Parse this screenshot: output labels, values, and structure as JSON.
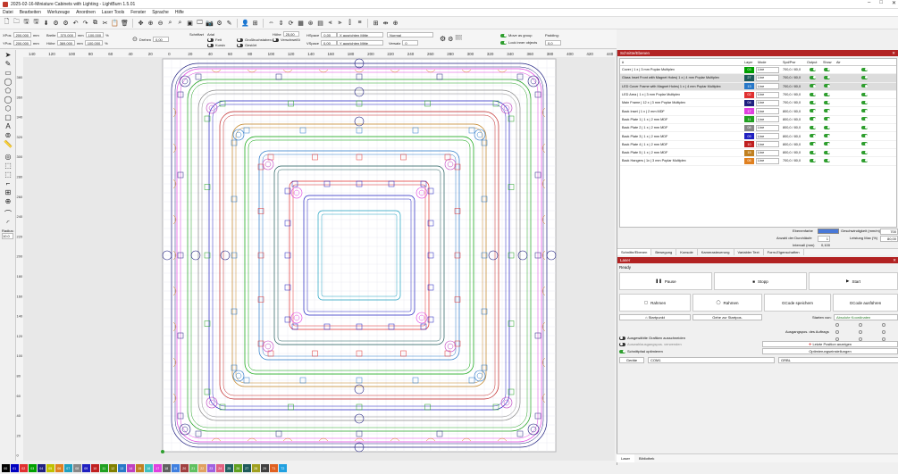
{
  "window": {
    "title": "2025-02-16-Miniature Cabinets with Lighting - LightBurn 1.5.01"
  },
  "menu": [
    "Datei",
    "Bearbeiten",
    "Werkzeuge",
    "Anordnen",
    "Laser Tools",
    "Fenster",
    "Sprache",
    "Hilfe"
  ],
  "props": {
    "xpos_label": "XPos",
    "xpos": "200.000",
    "ypos_label": "YPos",
    "ypos": "200.000",
    "unit": "mm",
    "width_label": "Breite",
    "width": "370.000",
    "height_label": "Höhe",
    "height": "369.000",
    "pct1": "100.000",
    "pct2": "100.000",
    "pct_unit": "%",
    "rotate_label": "Drehen",
    "rotate": "0,00",
    "font_label": "Schriftart",
    "font": "Arial",
    "height2_label": "Höhe",
    "height2": "25,00",
    "hspace_label": "HSpace",
    "hspace": "0,00",
    "vspace_label": "VSpace",
    "vspace": "0,00",
    "xalign": "X ausrichten Mitte",
    "yalign": "Y ausrichten Mitte",
    "normal": "Normal",
    "offset_label": "Versatz",
    "offset": "0",
    "bold": "Fett",
    "italic": "Kursiv",
    "upper": "Großbuchstaben",
    "welded": "Verschweißt",
    "distort": "Gestört",
    "move_group": "Move as group",
    "lock_inner": "Lock inner objects",
    "padding_label": "Padding:",
    "padding": "0,0"
  },
  "cuts": {
    "title": "Schnitte/Ebenen",
    "headers": {
      "hash": "#",
      "layer": "Layer",
      "mode": "Mode",
      "spdpwr": "Spd/Pwr",
      "output": "Output",
      "show": "Show",
      "air": "Air"
    },
    "rows": [
      {
        "name": "Cover | 1 x | 3 mm Poplar Multiplex",
        "num": "03",
        "color": "#00a000",
        "mode": "Line",
        "spd": "700,0 / 80,0"
      },
      {
        "name": "Glass Inset Front with Magnet Holes| 1 x | 4 mm Poplar Multiplex",
        "num": "27",
        "color": "#1e5a5a",
        "mode": "Line",
        "spd": "700,0 / 80,0"
      },
      {
        "name": "LED Cover Frame with Magnet Holes| 1 x | 4 mm Poplar Multiplex",
        "num": "13",
        "color": "#2878c8",
        "mode": "Line",
        "spd": "700,0 / 80,0"
      },
      {
        "name": "LED Area | 1 x | 3 mm Poplar Multiplex",
        "num": "02",
        "color": "#e03030",
        "mode": "Line",
        "spd": "700,0 / 80,0"
      },
      {
        "name": "Main Frame | 12 x | 3 mm Poplar Multiplex",
        "num": "04",
        "color": "#202080",
        "mode": "Line",
        "spd": "700,0 / 80,0"
      },
      {
        "name": "Back Inset | 1 x | 2 mm MDF",
        "num": "17",
        "color": "#e040e0",
        "mode": "Line",
        "spd": "800,0 / 80,0"
      },
      {
        "name": "Back Plate 1 | 1 x | 2 mm MDF",
        "num": "11",
        "color": "#20a020",
        "mode": "Line",
        "spd": "800,0 / 80,0"
      },
      {
        "name": "Back Plate 2 | 1 x | 2 mm MDF",
        "num": "08",
        "color": "#888888",
        "mode": "Line",
        "spd": "800,0 / 80,0"
      },
      {
        "name": "Back Plate 3 | 1 x | 2 mm MDF",
        "num": "09",
        "color": "#2020c0",
        "mode": "Line",
        "spd": "800,0 / 80,0"
      },
      {
        "name": "Back Plate 4 | 1 x | 2 mm MDF",
        "num": "10",
        "color": "#c02020",
        "mode": "Line",
        "spd": "800,0 / 80,0"
      },
      {
        "name": "Back Plate 5 | 1 x | 2 mm MDF",
        "num": "15",
        "color": "#c08020",
        "mode": "Line",
        "spd": "800,0 / 80,0"
      },
      {
        "name": "Back Hangers | 1x | 3 mm Poplar Multiplex",
        "num": "06",
        "color": "#e08020",
        "mode": "Line",
        "spd": "700,0 / 80,0"
      }
    ],
    "layer_color_label": "Ebenenfarbe",
    "speed_label": "Geschwindigkeit (mm/m)",
    "speed": "700",
    "passes_label": "Anzahl der Durchläufe",
    "passes": "1",
    "power_label": "Leistung Max (%)",
    "power": "80,00",
    "interval_label": "Intervall (mm)",
    "interval": "0,100"
  },
  "midtabs": [
    "Schnitte/Ebenen",
    "Bewegung",
    "Konsole",
    "Kamerasteuerung",
    "Variabler Text",
    "Form-Eigenschaften"
  ],
  "laser": {
    "title": "Laser",
    "status": "Ready",
    "pause": "Pause",
    "stop": "Stopp",
    "start": "Start",
    "frame1": "Rahmen",
    "frame2": "Rahmen",
    "save_gcode": "GCode speichern",
    "run_gcode": "GCode ausführen",
    "home": "Startpunkt",
    "goto_origin": "Gehe zur Startpos.",
    "start_from_label": "Starten von:",
    "start_from": "Absolute Koordinaten",
    "job_origin_label": "Ausgangspos. des Auftrags",
    "cut_selected": "Ausgewählte Grafiken ausschneiden",
    "use_selection_origin": "Auswahlausgangspos. verwenden",
    "optimize": "Schnittpfad optimieren",
    "show_last": "Letzte Position anzeigen",
    "opt_settings": "Optimierungseinstellungen",
    "devices_label": "Geräte",
    "device": "COM1",
    "device_type": "GRBL"
  },
  "bottomtabs": [
    "Laser",
    "Bibliothek"
  ],
  "radius_label": "Radius:",
  "radius": "10.0",
  "ruler_top": [
    "140",
    "120",
    "100",
    "80",
    "60",
    "40",
    "20",
    "0",
    "20",
    "40",
    "60",
    "80",
    "100",
    "120",
    "140",
    "160",
    "180",
    "200",
    "220",
    "240",
    "260",
    "280",
    "300",
    "320",
    "340",
    "360",
    "380",
    "400",
    "420",
    "440"
  ],
  "ruler_left": [
    "380",
    "360",
    "340",
    "320",
    "300",
    "280",
    "260",
    "240",
    "220",
    "200",
    "180",
    "160",
    "140",
    "120",
    "100",
    "80",
    "60",
    "40",
    "20",
    "0"
  ],
  "palette": [
    {
      "n": "00",
      "c": "#000000"
    },
    {
      "n": "01",
      "c": "#0000c0"
    },
    {
      "n": "02",
      "c": "#e03030"
    },
    {
      "n": "03",
      "c": "#00a000"
    },
    {
      "n": "04",
      "c": "#202080"
    },
    {
      "n": "05",
      "c": "#c0c000"
    },
    {
      "n": "06",
      "c": "#e08020"
    },
    {
      "n": "07",
      "c": "#20a0c0"
    },
    {
      "n": "08",
      "c": "#888888"
    },
    {
      "n": "09",
      "c": "#2020c0"
    },
    {
      "n": "10",
      "c": "#c02020"
    },
    {
      "n": "11",
      "c": "#20a020"
    },
    {
      "n": "12",
      "c": "#808000"
    },
    {
      "n": "13",
      "c": "#2878c8"
    },
    {
      "n": "14",
      "c": "#c040c0"
    },
    {
      "n": "15",
      "c": "#c08020"
    },
    {
      "n": "16",
      "c": "#40c0c0"
    },
    {
      "n": "17",
      "c": "#e040e0"
    },
    {
      "n": "18",
      "c": "#606060"
    },
    {
      "n": "19",
      "c": "#4080e0"
    },
    {
      "n": "20",
      "c": "#a04040"
    },
    {
      "n": "21",
      "c": "#60c060"
    },
    {
      "n": "22",
      "c": "#e0a060"
    },
    {
      "n": "23",
      "c": "#a060e0"
    },
    {
      "n": "24",
      "c": "#e06080"
    },
    {
      "n": "25",
      "c": "#206060"
    },
    {
      "n": "26",
      "c": "#60a020"
    },
    {
      "n": "27",
      "c": "#1e5a5a"
    },
    {
      "n": "28",
      "c": "#a0a020"
    },
    {
      "n": "29",
      "c": "#404040"
    },
    {
      "n": "T1",
      "c": "#e06020"
    },
    {
      "n": "T2",
      "c": "#20a0e0"
    }
  ]
}
